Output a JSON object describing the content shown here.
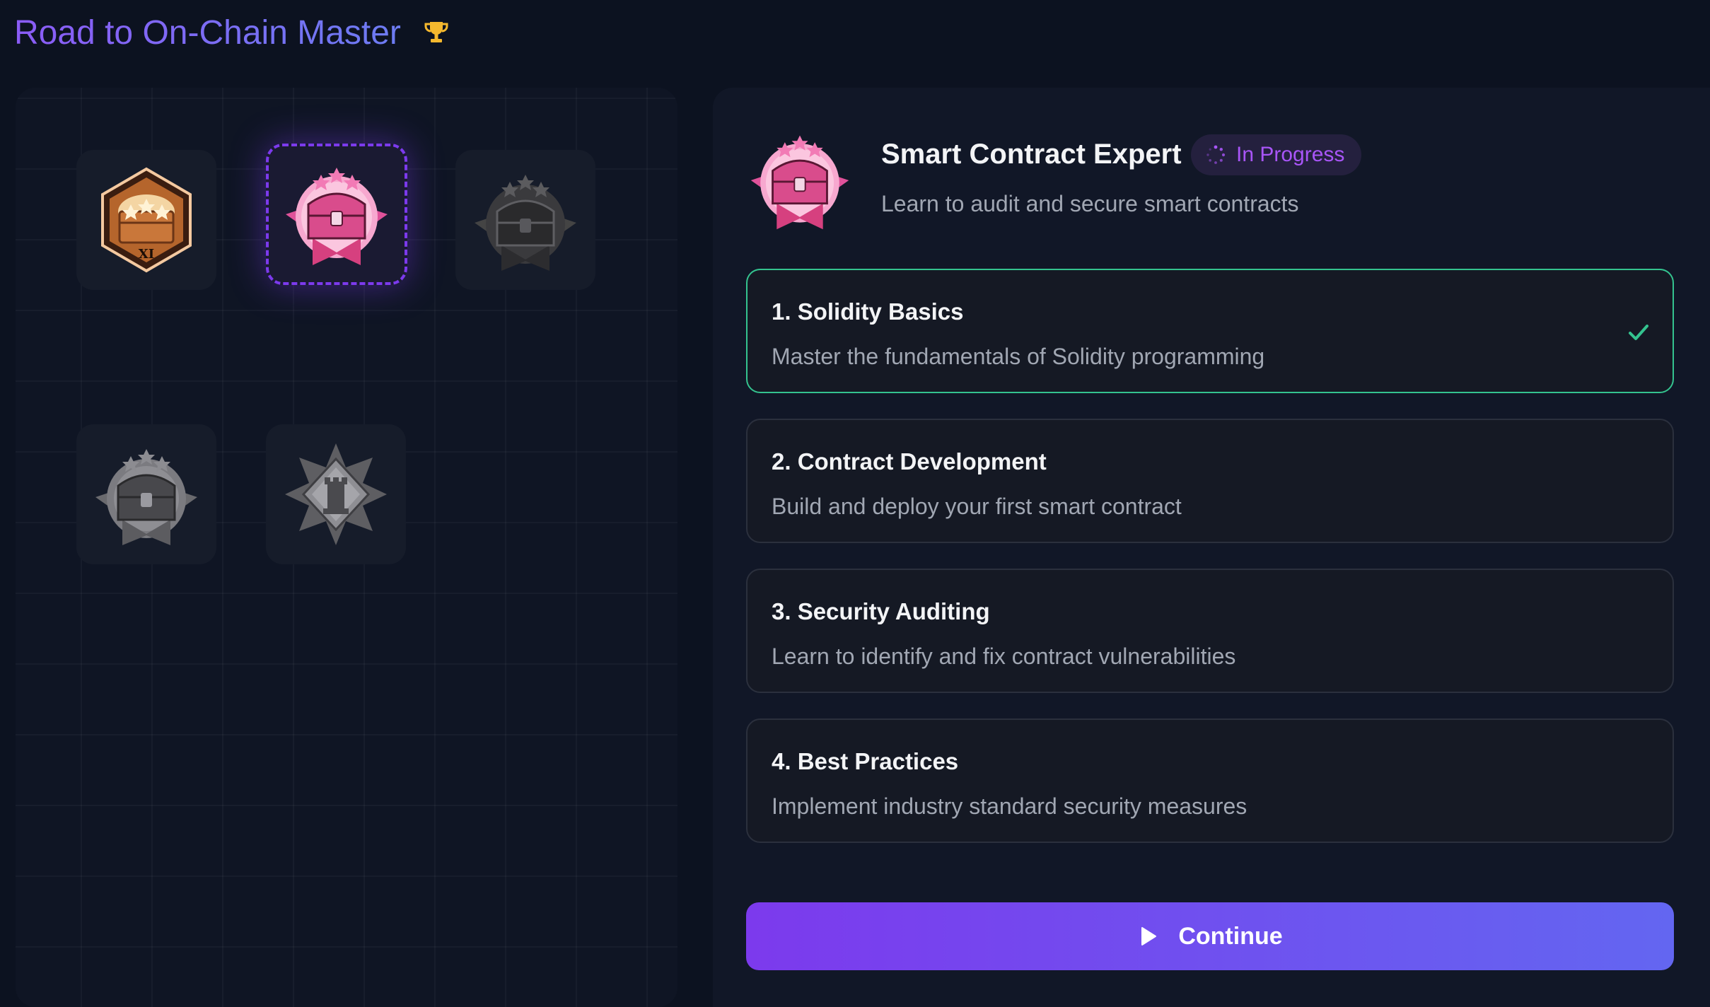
{
  "header": {
    "title": "Road to On-Chain Master",
    "trophy_icon": "trophy-icon"
  },
  "badges": [
    {
      "name": "bronze-chest-badge",
      "state": "completed",
      "label": "XI"
    },
    {
      "name": "pink-chest-badge",
      "state": "selected"
    },
    {
      "name": "locked-chest-badge-1",
      "state": "locked"
    },
    {
      "name": "locked-chest-badge-2",
      "state": "locked"
    },
    {
      "name": "locked-tower-badge",
      "state": "locked"
    }
  ],
  "detail": {
    "title": "Smart Contract Expert",
    "status": "In Progress",
    "subtitle": "Learn to audit and secure smart contracts"
  },
  "steps": [
    {
      "title": "1. Solidity Basics",
      "description": "Master the fundamentals of Solidity programming",
      "completed": true
    },
    {
      "title": "2. Contract Development",
      "description": "Build and deploy your first smart contract",
      "completed": false
    },
    {
      "title": "3. Security Auditing",
      "description": "Learn to identify and fix contract vulnerabilities",
      "completed": false
    },
    {
      "title": "4. Best Practices",
      "description": "Implement industry standard security measures",
      "completed": false
    }
  ],
  "actions": {
    "continue_label": "Continue"
  },
  "colors": {
    "accent_purple": "#7c3aed",
    "accent_indigo": "#6366f1",
    "success_green": "#34c38f",
    "background": "#0c1220"
  }
}
